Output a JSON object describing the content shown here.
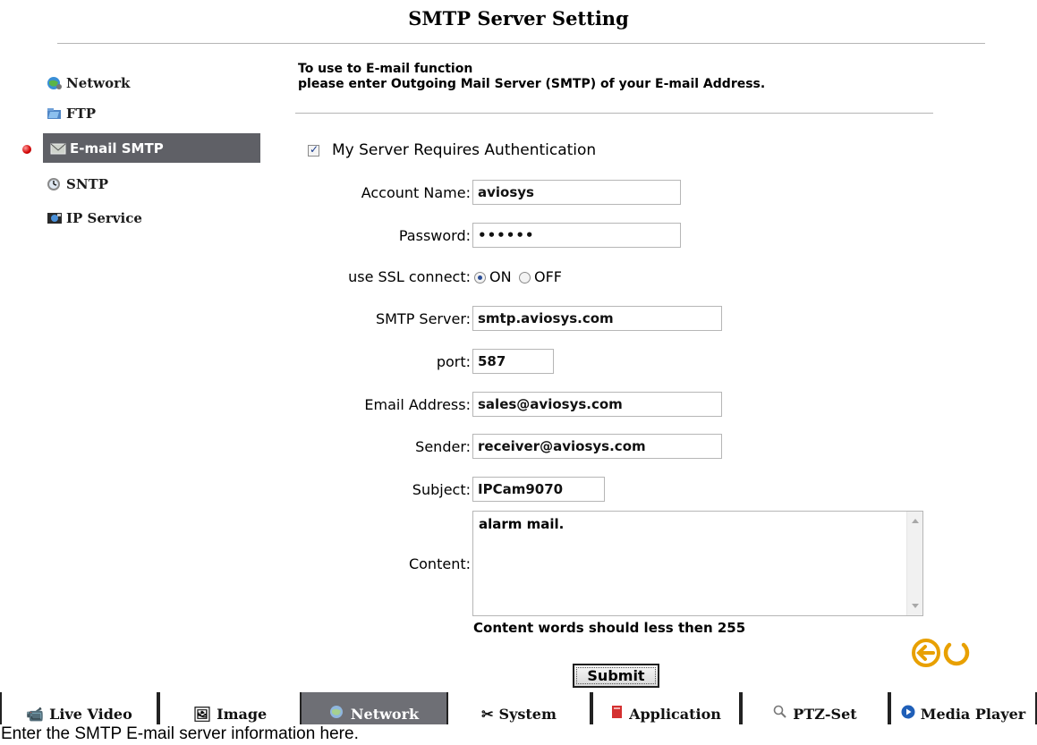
{
  "title": "SMTP Server Setting",
  "sidebar": {
    "items": [
      {
        "label": "Network",
        "icon": "network-globe-icon"
      },
      {
        "label": "FTP",
        "icon": "ftp-folder-icon"
      },
      {
        "label": "E-mail SMTP",
        "icon": "email-envelope-icon"
      },
      {
        "label": "SNTP",
        "icon": "sntp-clock-icon"
      },
      {
        "label": "IP Service",
        "icon": "ip-service-icon"
      }
    ]
  },
  "intro": {
    "line1": "To use to E-mail function",
    "line2": "please enter Outgoing Mail Server (SMTP) of your E-mail Address."
  },
  "form": {
    "auth_label": "My Server Requires Authentication",
    "auth_checked": true,
    "account_label": "Account Name:",
    "account_value": "aviosys",
    "password_label": "Password:",
    "password_value": "••••••",
    "ssl_label": "use SSL connect:",
    "ssl_on": "ON",
    "ssl_off": "OFF",
    "ssl_value": "ON",
    "smtp_label": "SMTP Server:",
    "smtp_value": "smtp.aviosys.com",
    "port_label": "port:",
    "port_value": "587",
    "email_label": "Email Address:",
    "email_value": "sales@aviosys.com",
    "sender_label": "Sender:",
    "sender_value": "receiver@aviosys.com",
    "subject_label": "Subject:",
    "subject_value": "IPCam9070",
    "content_label": "Content:",
    "content_value": "alarm mail.",
    "content_note": "Content words should less then 255",
    "submit_label": "Submit"
  },
  "tabs": [
    {
      "label": "Live Video",
      "icon": "camera-icon"
    },
    {
      "label": "Image",
      "icon": "image-icon"
    },
    {
      "label": "Network",
      "icon": "network-icon",
      "selected": true
    },
    {
      "label": "System",
      "icon": "tools-icon"
    },
    {
      "label": "Application",
      "icon": "application-icon"
    },
    {
      "label": "PTZ-Set",
      "icon": "magnifier-icon"
    },
    {
      "label": "Media Player",
      "icon": "play-icon"
    }
  ],
  "caption": "Enter the SMTP E-mail server information here.",
  "colors": {
    "active_bg": "#5f6066",
    "tab_selected_bg": "#6e6f75",
    "nav_orange": "#e8a000"
  }
}
